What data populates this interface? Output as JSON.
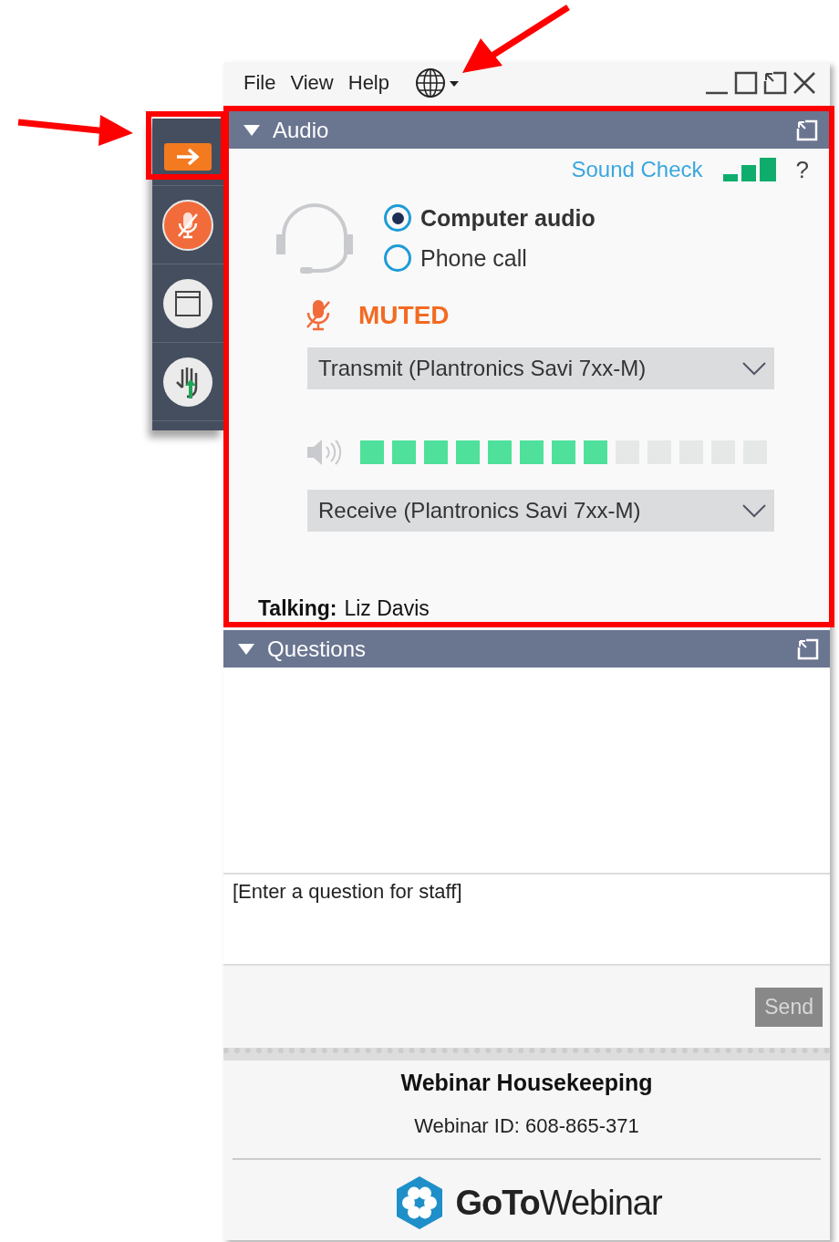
{
  "menu": [
    "File",
    "View",
    "Help"
  ],
  "toolbar": [
    {
      "kind": "arrow"
    },
    {
      "kind": "mic-muted"
    },
    {
      "kind": "window"
    },
    {
      "kind": "hand"
    }
  ],
  "audio": {
    "title": "Audio",
    "sound_check": "Sound Check",
    "help": "?",
    "options": [
      {
        "label": "Computer audio",
        "selected": true
      },
      {
        "label": "Phone call",
        "selected": false
      }
    ],
    "mute_status": "MUTED",
    "transmit": "Transmit (Plantronics Savi 7xx-M)",
    "speaker": {
      "level": 0.615
    },
    "receive": "Receive (Plantronics Savi 7xx-M)",
    "talking_label": "Talking:",
    "talking_name": "Liz Davis"
  },
  "questions": {
    "title": "Questions",
    "placeholder": "[Enter a question for staff]",
    "send": {
      "label": "Send",
      "disabled": true
    }
  },
  "footer": {
    "title": "Webinar Housekeeping",
    "webinar_id": "Webinar ID: 608-865-371",
    "logo": "**GoTo**Webinar"
  }
}
